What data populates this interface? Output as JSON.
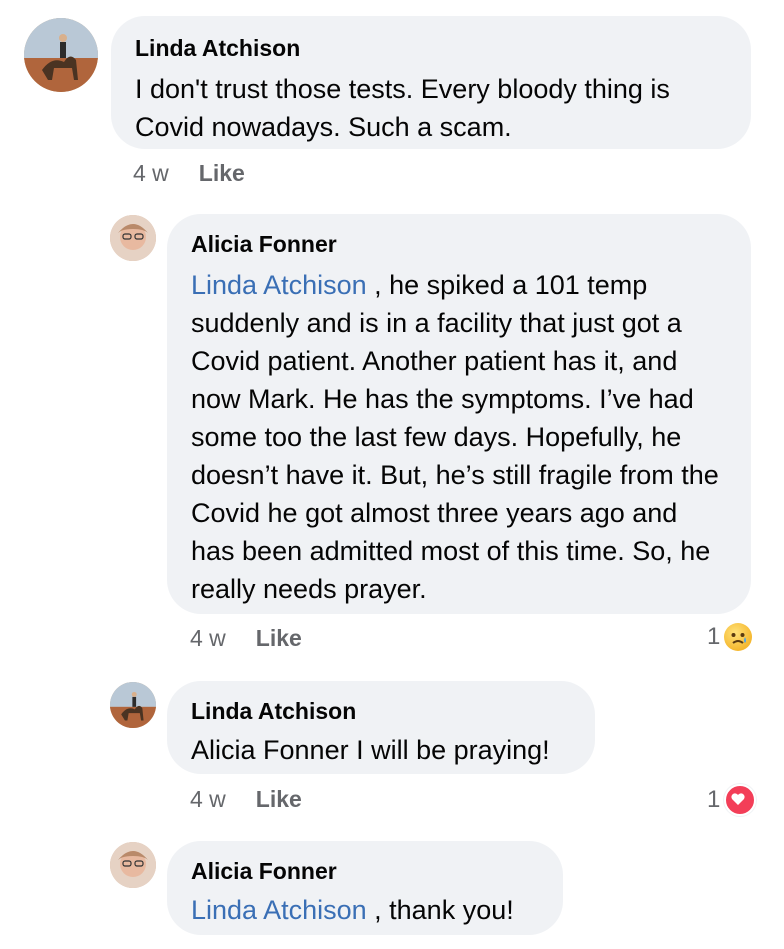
{
  "comments": [
    {
      "author": "Linda Atchison",
      "text": "I don't trust those tests.  Every bloody thing is Covid nowadays.  Such a scam.",
      "time": "4 w",
      "like_label": "Like"
    },
    {
      "author": "Alicia Fonner",
      "mention": "Linda Atchison",
      "text": " , he spiked a 101 temp suddenly and is in a facility that just got a Covid patient. Another patient has it, and now Mark. He has the symptoms. I’ve had some too the last few days. Hopefully, he doesn’t have it. But, he’s still fragile from the Covid he got almost three years ago and has been admitted most of this time. So, he really needs prayer.",
      "time": "4 w",
      "like_label": "Like",
      "reaction_count": "1",
      "reaction_icon": "sad-emoji-icon"
    },
    {
      "author": "Linda Atchison",
      "text": "Alicia Fonner I will be praying!",
      "time": "4 w",
      "like_label": "Like",
      "reaction_count": "1",
      "reaction_icon": "love-heart-icon"
    },
    {
      "author": "Alicia Fonner",
      "mention": "Linda Atchison",
      "text": " , thank you!"
    }
  ],
  "colors": {
    "bubble": "#f0f2f5",
    "mention": "#3a6fb5",
    "meta": "#65676b",
    "love": "#f33e58"
  }
}
